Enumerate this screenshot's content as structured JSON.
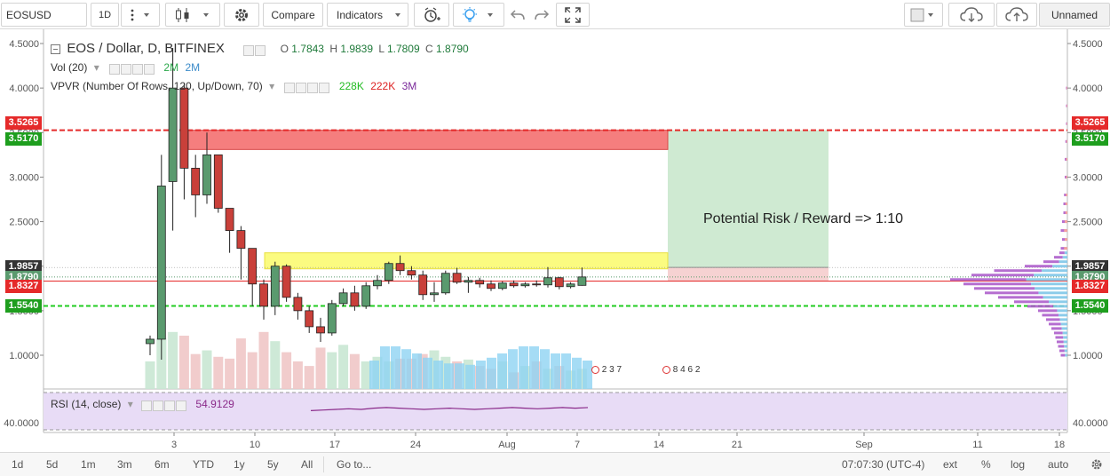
{
  "toolbar": {
    "symbol": "EOSUSD",
    "interval": "1D",
    "compare_label": "Compare",
    "indicators_label": "Indicators",
    "layout_name": "Unnamed"
  },
  "legend": {
    "title": "EOS / Dollar, D, BITFINEX",
    "o_label": "O",
    "o": "1.7843",
    "h_label": "H",
    "h": "1.9839",
    "l_label": "L",
    "l": "1.7809",
    "c_label": "C",
    "c": "1.8790",
    "vol_label": "Vol (20)",
    "vol_a": "2M",
    "vol_b": "2M",
    "vpvr_label": "VPVR (Number Of Rows, 120, Up/Down, 70)",
    "vpvr_up": "228K",
    "vpvr_down": "222K",
    "vpvr_total": "3M",
    "rsi_label": "RSI (14, close)",
    "rsi_value": "54.9129"
  },
  "annotation": "Potential Risk / Reward => 1:10",
  "colors": {
    "up": "#53b987",
    "down": "#eb4d5c",
    "up_dark": "#5a9a6e",
    "down_dark": "#c0392b",
    "red_line": "#e52a2a",
    "green_line": "#22cc22",
    "rsi": "#8a2a8a"
  },
  "price_axis": {
    "ticks": [
      "4.5000",
      "4.0000",
      "3.5000",
      "3.0000",
      "2.5000",
      "2.0000",
      "1.5000",
      "1.0000"
    ],
    "tags": [
      {
        "label": "3.5265",
        "color": "#e52a2a"
      },
      {
        "label": "3.5170",
        "color": "#1e9e1e"
      },
      {
        "label": "1.9857",
        "color": "#333333"
      },
      {
        "label": "1.8790",
        "color": "#5a9a6e"
      },
      {
        "label": "1.8327",
        "color": "#e52a2a"
      },
      {
        "label": "1.5540",
        "color": "#1e9e1e"
      }
    ],
    "rsi_tick": "40.0000"
  },
  "time_axis": [
    "3",
    "10",
    "17",
    "24",
    "Aug",
    "7",
    "14",
    "21",
    "Sep",
    "11",
    "18"
  ],
  "events": {
    "a": [
      "2",
      "3",
      "7"
    ],
    "b": [
      "8",
      "4",
      "6",
      "2"
    ]
  },
  "bottom": {
    "ranges": [
      "1d",
      "5d",
      "1m",
      "3m",
      "6m",
      "YTD",
      "1y",
      "5y",
      "All"
    ],
    "goto": "Go to...",
    "clock": "07:07:30 (UTC-4)",
    "opts": [
      "ext",
      "%",
      "log",
      "auto"
    ]
  },
  "chart_data": {
    "type": "candlestick",
    "candles": [
      {
        "o": 1.13,
        "h": 1.22,
        "l": 1.0,
        "c": 1.18
      },
      {
        "o": 1.18,
        "h": 3.25,
        "l": 0.95,
        "c": 2.9
      },
      {
        "o": 2.95,
        "h": 4.45,
        "l": 2.4,
        "c": 4.0
      },
      {
        "o": 4.0,
        "h": 4.05,
        "l": 2.75,
        "c": 3.1
      },
      {
        "o": 3.1,
        "h": 3.25,
        "l": 2.55,
        "c": 2.8
      },
      {
        "o": 2.8,
        "h": 3.5,
        "l": 2.7,
        "c": 3.25
      },
      {
        "o": 3.25,
        "h": 3.25,
        "l": 2.6,
        "c": 2.65
      },
      {
        "o": 2.65,
        "h": 2.65,
        "l": 2.15,
        "c": 2.4
      },
      {
        "o": 2.4,
        "h": 2.45,
        "l": 1.85,
        "c": 2.2
      },
      {
        "o": 2.2,
        "h": 2.2,
        "l": 1.55,
        "c": 1.8
      },
      {
        "o": 1.8,
        "h": 1.85,
        "l": 1.4,
        "c": 1.55
      },
      {
        "o": 1.55,
        "h": 2.05,
        "l": 1.45,
        "c": 2.0
      },
      {
        "o": 2.0,
        "h": 2.02,
        "l": 1.6,
        "c": 1.65
      },
      {
        "o": 1.65,
        "h": 1.7,
        "l": 1.4,
        "c": 1.5
      },
      {
        "o": 1.5,
        "h": 1.55,
        "l": 1.25,
        "c": 1.32
      },
      {
        "o": 1.32,
        "h": 1.42,
        "l": 1.15,
        "c": 1.25
      },
      {
        "o": 1.25,
        "h": 1.62,
        "l": 1.22,
        "c": 1.58
      },
      {
        "o": 1.58,
        "h": 1.75,
        "l": 1.55,
        "c": 1.7
      },
      {
        "o": 1.7,
        "h": 1.78,
        "l": 1.5,
        "c": 1.55
      },
      {
        "o": 1.55,
        "h": 1.82,
        "l": 1.52,
        "c": 1.78
      },
      {
        "o": 1.78,
        "h": 1.9,
        "l": 1.74,
        "c": 1.84
      },
      {
        "o": 1.84,
        "h": 2.05,
        "l": 1.8,
        "c": 2.03
      },
      {
        "o": 2.03,
        "h": 2.12,
        "l": 1.9,
        "c": 1.95
      },
      {
        "o": 1.95,
        "h": 2.0,
        "l": 1.85,
        "c": 1.9
      },
      {
        "o": 1.9,
        "h": 1.95,
        "l": 1.62,
        "c": 1.68
      },
      {
        "o": 1.68,
        "h": 1.82,
        "l": 1.6,
        "c": 1.7
      },
      {
        "o": 1.7,
        "h": 1.95,
        "l": 1.68,
        "c": 1.92
      },
      {
        "o": 1.92,
        "h": 1.98,
        "l": 1.8,
        "c": 1.82
      },
      {
        "o": 1.82,
        "h": 1.88,
        "l": 1.7,
        "c": 1.84
      },
      {
        "o": 1.84,
        "h": 1.87,
        "l": 1.76,
        "c": 1.8
      },
      {
        "o": 1.8,
        "h": 1.84,
        "l": 1.72,
        "c": 1.75
      },
      {
        "o": 1.75,
        "h": 1.83,
        "l": 1.73,
        "c": 1.81
      },
      {
        "o": 1.81,
        "h": 1.84,
        "l": 1.76,
        "c": 1.78
      },
      {
        "o": 1.78,
        "h": 1.82,
        "l": 1.76,
        "c": 1.8
      },
      {
        "o": 1.8,
        "h": 1.84,
        "l": 1.77,
        "c": 1.79
      },
      {
        "o": 1.79,
        "h": 1.99,
        "l": 1.76,
        "c": 1.87
      },
      {
        "o": 1.87,
        "h": 1.88,
        "l": 1.74,
        "c": 1.77
      },
      {
        "o": 1.77,
        "h": 1.82,
        "l": 1.75,
        "c": 1.8
      },
      {
        "o": 1.7843,
        "h": 1.9839,
        "l": 1.7809,
        "c": 1.879
      }
    ],
    "volume": [
      0.3,
      0.55,
      0.62,
      0.58,
      0.38,
      0.42,
      0.35,
      0.33,
      0.55,
      0.4,
      0.62,
      0.52,
      0.4,
      0.3,
      0.25,
      0.45,
      0.4,
      0.48,
      0.38,
      0.3,
      0.35,
      0.3,
      0.33,
      0.33,
      0.38,
      0.42,
      0.35,
      0.3,
      0.32,
      0.25,
      0.22,
      0.3,
      0.18,
      0.25,
      0.3,
      0.22,
      0.25,
      0.2,
      0.22
    ],
    "levels": [
      {
        "price": 3.5265,
        "style": "dashed-red"
      },
      {
        "price": 1.8327,
        "style": "solid-red"
      },
      {
        "price": 1.554,
        "style": "dashed-green"
      }
    ],
    "zones": [
      {
        "name": "supply-zone",
        "from": 3.31,
        "to": 3.5265
      },
      {
        "name": "entry-zone",
        "from": 1.97,
        "to": 2.15
      },
      {
        "name": "reward-zone",
        "from": 1.9857,
        "to": 3.5265
      },
      {
        "name": "risk-zone",
        "from": 1.8327,
        "to": 1.9857
      }
    ],
    "rsi": [
      50,
      51,
      52,
      53,
      52,
      54,
      55,
      54,
      53,
      52,
      53,
      54,
      53,
      52,
      53,
      54,
      55,
      54,
      53,
      54,
      55,
      54,
      54.9129
    ],
    "ylim": [
      0.65,
      4.65
    ]
  }
}
